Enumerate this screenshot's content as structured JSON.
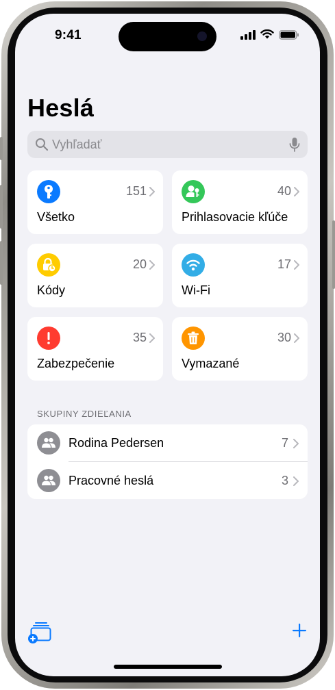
{
  "status_bar": {
    "time": "9:41"
  },
  "title": "Heslá",
  "search": {
    "placeholder": "Vyhľadať"
  },
  "categories": [
    {
      "label": "Všetko",
      "count": "151",
      "icon": "key-icon",
      "color": "#0a7aff"
    },
    {
      "label": "Prihlasovacie kľúče",
      "count": "40",
      "icon": "person-key-icon",
      "color": "#34c759"
    },
    {
      "label": "Kódy",
      "count": "20",
      "icon": "lock-clock-icon",
      "color": "#ffcc00"
    },
    {
      "label": "Wi-Fi",
      "count": "17",
      "icon": "wifi-icon",
      "color": "#32ade6"
    },
    {
      "label": "Zabezpečenie",
      "count": "35",
      "icon": "exclamation-icon",
      "color": "#ff3b30"
    },
    {
      "label": "Vymazané",
      "count": "30",
      "icon": "trash-icon",
      "color": "#ff9500"
    }
  ],
  "shared_groups": {
    "header": "SKUPINY ZDIEĽANIA",
    "items": [
      {
        "name": "Rodina Pedersen",
        "count": "7",
        "icon": "group-people-icon"
      },
      {
        "name": "Pracovné heslá",
        "count": "3",
        "icon": "group-people-icon"
      }
    ]
  },
  "toolbar": {
    "left_icon": "new-group-icon",
    "right_icon": "plus-icon"
  },
  "accent_color": "#0a7aff"
}
